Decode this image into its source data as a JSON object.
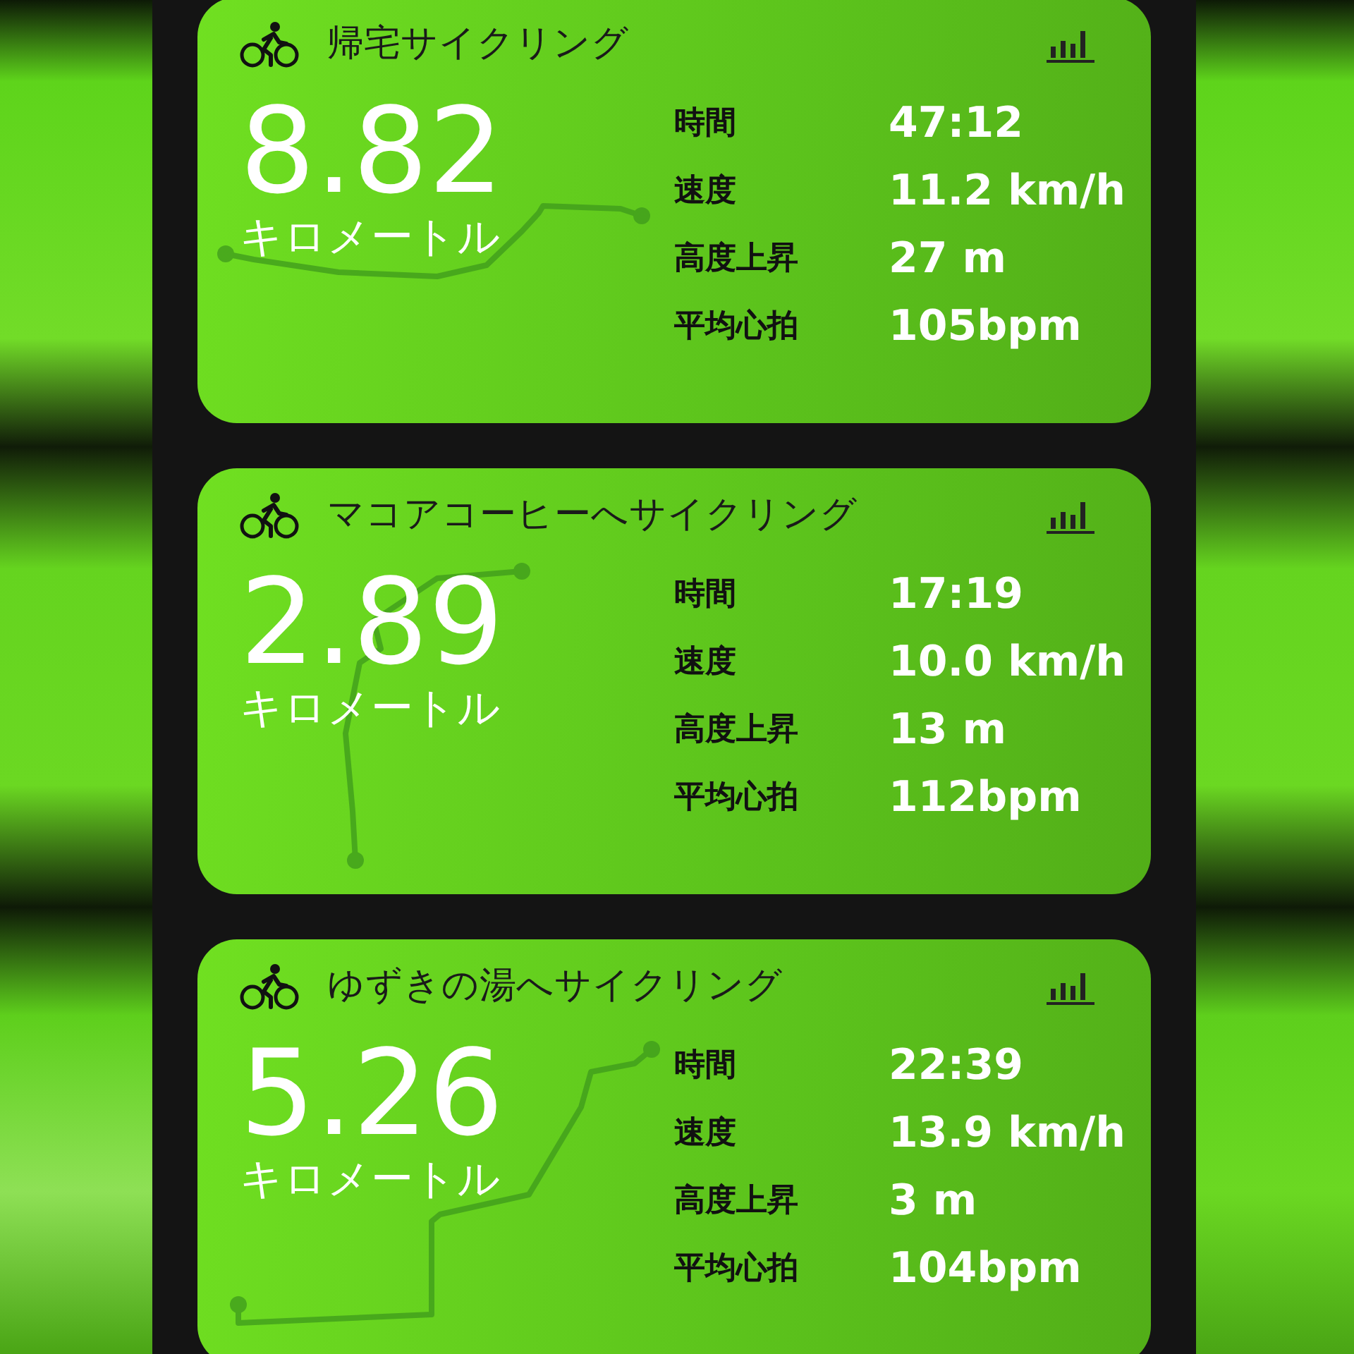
{
  "cards": [
    {
      "title": "帰宅サイクリング",
      "distance": "8.82",
      "unit": "キロメートル",
      "stats": [
        {
          "label": "時間",
          "value": "47:12"
        },
        {
          "label": "速度",
          "value": "11.2 km/h"
        },
        {
          "label": "高度上昇",
          "value": "27 m"
        },
        {
          "label": "平均心拍",
          "value": "105bpm"
        }
      ]
    },
    {
      "title": "マコアコーヒーへサイクリング",
      "distance": "2.89",
      "unit": "キロメートル",
      "stats": [
        {
          "label": "時間",
          "value": "17:19"
        },
        {
          "label": "速度",
          "value": "10.0 km/h"
        },
        {
          "label": "高度上昇",
          "value": "13 m"
        },
        {
          "label": "平均心拍",
          "value": "112bpm"
        }
      ]
    },
    {
      "title": "ゆずきの湯へサイクリング",
      "distance": "5.26",
      "unit": "キロメートル",
      "stats": [
        {
          "label": "時間",
          "value": "22:39"
        },
        {
          "label": "速度",
          "value": "13.9 km/h"
        },
        {
          "label": "高度上昇",
          "value": "3 m"
        },
        {
          "label": "平均心拍",
          "value": "104bpm"
        }
      ]
    }
  ]
}
